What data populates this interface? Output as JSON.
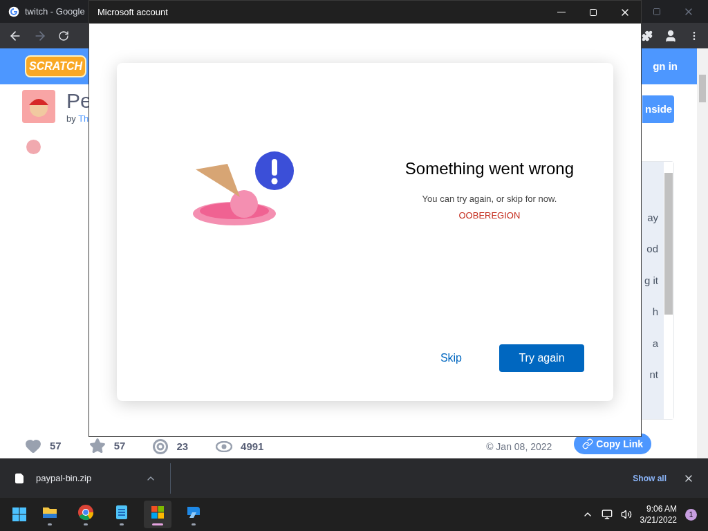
{
  "browser": {
    "tab_title": "twitch - Google"
  },
  "page": {
    "logo": "SCRATCH",
    "sign_in": "gn in",
    "project_title": "Pe",
    "by_label": "by",
    "author": "Th",
    "see_inside": "nside",
    "notes_fragments": [
      "ay",
      "od",
      "g it",
      "h",
      "a",
      "nt"
    ],
    "stats": [
      {
        "kind": "heart",
        "value": "57"
      },
      {
        "kind": "star",
        "value": "57"
      },
      {
        "kind": "remix",
        "value": "23"
      },
      {
        "kind": "eye",
        "value": "4991"
      }
    ],
    "date": "© Jan 08, 2022",
    "copy_link": "Copy Link"
  },
  "dialog": {
    "title": "Microsoft account",
    "heading": "Something went wrong",
    "message": "You can try again, or skip for now.",
    "error_code": "OOBEREGION",
    "skip": "Skip",
    "try_again": "Try again"
  },
  "downloads": {
    "file": "paypal-bin.zip",
    "show_all": "Show all"
  },
  "taskbar": {
    "apps": [
      {
        "kind": "explorer",
        "selected": false
      },
      {
        "kind": "chrome",
        "selected": false
      },
      {
        "kind": "notepad",
        "selected": false
      },
      {
        "kind": "store",
        "selected": true
      },
      {
        "kind": "remote",
        "selected": false
      }
    ],
    "time": "9:06 AM",
    "date": "3/21/2022",
    "notifications": "1"
  }
}
